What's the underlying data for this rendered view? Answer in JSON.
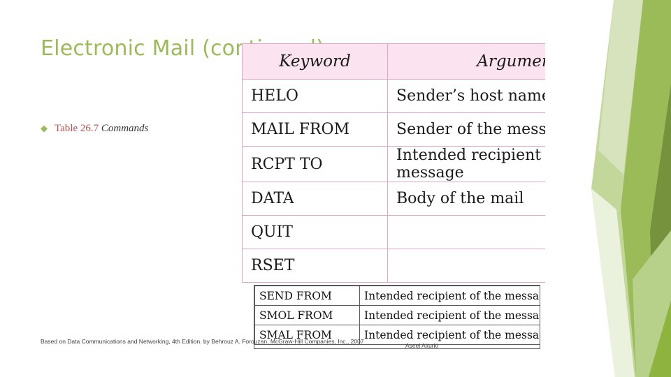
{
  "slide": {
    "title": "Electronic Mail (continued)",
    "bullet_marker": "◆",
    "table_label": "Table 26.7",
    "table_caption": "Commands",
    "footer_left": "Based on Data Communications and Networking, 4th Edition. by Behrouz A. Forouzan, McGraw-Hill Companies, Inc., 2007",
    "footer_right": "Aseel Alturki",
    "accent_title_color": "#9bbb59",
    "accent_label_color": "#c0504d",
    "table_header_fill": "#fbe4ef",
    "table_border_color": "#e0a7c4"
  },
  "main_table": {
    "headers": [
      "Keyword",
      "Argument(s)"
    ],
    "rows": [
      [
        "HELO",
        "Sender’s host name"
      ],
      [
        "MAIL FROM",
        "Sender of the message"
      ],
      [
        "RCPT TO",
        "Intended recipient of the message"
      ],
      [
        "DATA",
        "Body of the mail"
      ],
      [
        "QUIT",
        ""
      ],
      [
        "RSET",
        ""
      ]
    ]
  },
  "overlay_table": {
    "rows": [
      [
        "SEND FROM",
        "Intended recipient of the message"
      ],
      [
        "SMOL FROM",
        "Intended recipient of the message"
      ],
      [
        "SMAL FROM",
        "Intended recipient of the message"
      ]
    ]
  }
}
